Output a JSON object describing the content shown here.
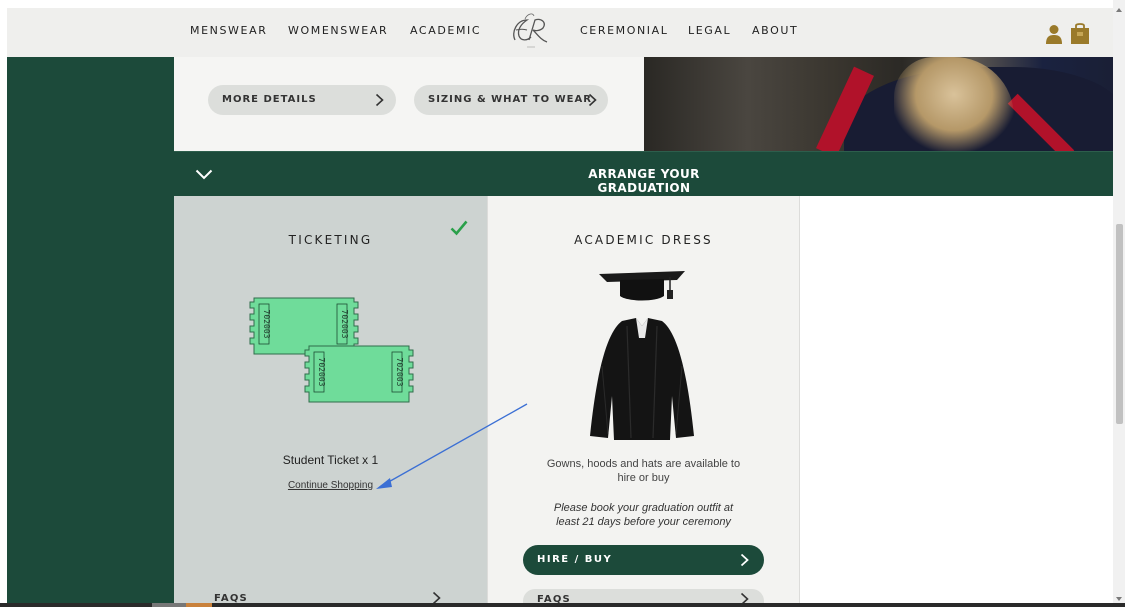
{
  "nav": {
    "left_items": [
      "MENSWEAR",
      "WOMENSWEAR",
      "ACADEMIC"
    ],
    "right_items": [
      "CEREMONIAL",
      "LEGAL",
      "ABOUT"
    ],
    "logo_icon": "er-monogram-logo",
    "user_icon": "user-icon",
    "bag_icon": "shopping-bag-icon"
  },
  "upper": {
    "more_details_label": "MORE DETAILS",
    "sizing_label": "SIZING & WHAT TO WEAR"
  },
  "section": {
    "title": "ARRANGE YOUR GRADUATION",
    "toggle_icon": "chevron-down-icon"
  },
  "ticketing": {
    "title": "TICKETING",
    "status_icon": "checkmark-icon",
    "ticket_line": "Student Ticket x 1",
    "continue_label": "Continue Shopping",
    "ticket_number": "702003",
    "faqs_label": "FAQS"
  },
  "academic_dress": {
    "title": "ACADEMIC DRESS",
    "description_line1": "Gowns, hoods and hats are available to",
    "description_line2": "hire or buy",
    "note_line1": "Please book your graduation outfit at",
    "note_line2": "least 21 days before your ceremony",
    "hire_buy_label": "HIRE / BUY",
    "faqs_label": "FAQS"
  },
  "colors": {
    "brand_green": "#1c4a3a",
    "ticket_green": "#6fdc9a",
    "check_green": "#2aa04a",
    "gold": "#9a7a2a",
    "annotation_blue": "#3b6fd4"
  }
}
